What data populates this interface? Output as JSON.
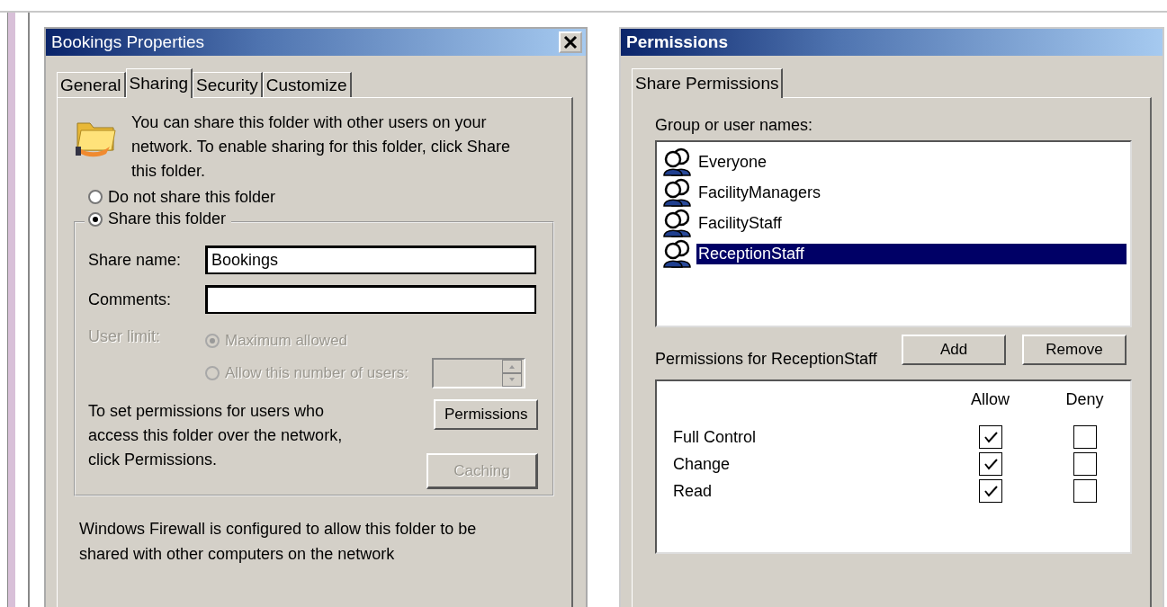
{
  "properties_dialog": {
    "title": "Bookings Properties",
    "tabs": [
      {
        "label": "General",
        "selected": false
      },
      {
        "label": "Sharing",
        "selected": true
      },
      {
        "label": "Security",
        "selected": false
      },
      {
        "label": "Customize",
        "selected": false
      }
    ],
    "intro": "You can share this folder with other users on your network.  To enable sharing for this folder, click Share this folder.",
    "sharing_options": [
      {
        "label": "Do not share this folder",
        "selected": false
      },
      {
        "label": "Share this folder",
        "selected": true
      }
    ],
    "share_name": {
      "label": "Share name:",
      "value": "Bookings"
    },
    "comments": {
      "label": "Comments:"
    },
    "user_limit": {
      "label": "User limit:",
      "disabled": true,
      "options": [
        {
          "label": "Maximum allowed",
          "selected": true
        },
        {
          "label": "Allow this number of users:",
          "selected": false
        }
      ]
    },
    "permissions_text": "To set permissions for users who access this folder over the network, click Permissions.",
    "buttons": [
      {
        "label": "Permissions",
        "disabled": false
      },
      {
        "label": "Caching",
        "disabled": true
      }
    ],
    "firewall_note": "Windows Firewall is configured to allow this folder to be shared with other computers on the network"
  },
  "permissions_dialog": {
    "title": "Permissions",
    "tabs": [
      {
        "label": "Share Permissions",
        "selected": true
      }
    ],
    "group_label": "Group or user names:",
    "users": [
      {
        "name": "Everyone",
        "selected": false
      },
      {
        "name": "FacilityManagers",
        "selected": false
      },
      {
        "name": "FacilityStaff",
        "selected": false
      },
      {
        "name": "ReceptionStaff",
        "selected": true
      }
    ],
    "buttons": [
      {
        "label": "Add"
      },
      {
        "label": "Remove"
      }
    ],
    "permissions_label": "Permissions for ReceptionStaff",
    "columns": [
      "Allow",
      "Deny"
    ],
    "permissions": [
      {
        "name": "Full Control",
        "allow": true,
        "deny": false
      },
      {
        "name": "Change",
        "allow": true,
        "deny": false
      },
      {
        "name": "Read",
        "allow": true,
        "deny": false
      }
    ]
  }
}
